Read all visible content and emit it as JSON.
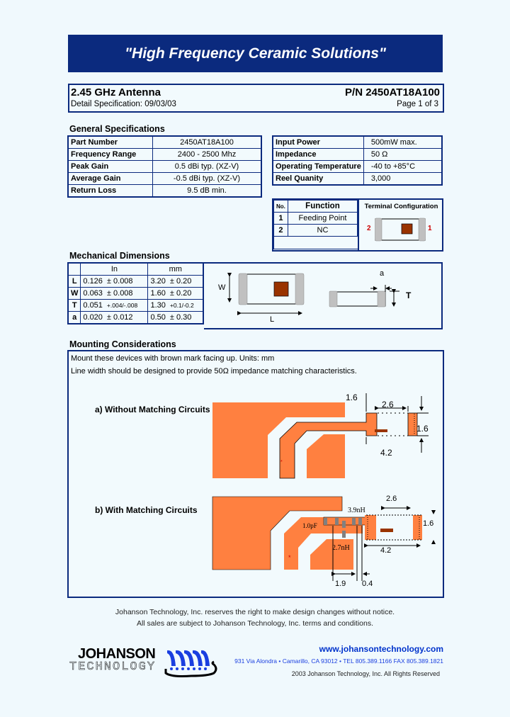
{
  "banner": {
    "slogan": "\"High Frequency Ceramic Solutions\""
  },
  "header": {
    "title": "2.45 GHz Antenna",
    "part_number": "P/N 2450AT18A100",
    "detail_spec": "Detail Specification:   09/03/03",
    "page": "Page 1 of 3"
  },
  "general_specs": {
    "heading": "General Specifications",
    "left_rows": [
      {
        "label": "Part Number",
        "value": "2450AT18A100"
      },
      {
        "label": "Frequency Range",
        "value": "2400 - 2500 Mhz"
      },
      {
        "label": "Peak Gain",
        "value": "0.5  dBi typ. (XZ-V)"
      },
      {
        "label": "Average Gain",
        "value": "-0.5  dBi typ. (XZ-V)"
      },
      {
        "label": "Return Loss",
        "value": "9.5 dB min."
      }
    ],
    "right_rows": [
      {
        "label": "Input Power",
        "value": "500mW max."
      },
      {
        "label": "Impedance",
        "value": "50 Ω"
      },
      {
        "label": "Operating Temperature",
        "value": "-40 to +85°C"
      },
      {
        "label": "Reel Quanity",
        "value": "3,000"
      }
    ]
  },
  "terminal": {
    "headers": {
      "no": "No.",
      "function": "Function",
      "config": "Terminal Configuration"
    },
    "rows": [
      {
        "no": "1",
        "function": "Feeding Point"
      },
      {
        "no": "2",
        "function": "NC"
      }
    ],
    "pin_left": "2",
    "pin_right": "1"
  },
  "mechanical": {
    "heading": "Mechanical Dimensions",
    "headers": {
      "in": "In",
      "mm": "mm"
    },
    "rows": [
      {
        "dim": "L",
        "in_val": "0.126",
        "in_tol": "±  0.008",
        "mm_val": "3.20",
        "mm_tol": "±  0.20"
      },
      {
        "dim": "W",
        "in_val": "0.063",
        "in_tol": "±  0.008",
        "mm_val": "1.60",
        "mm_tol": "±  0.20"
      },
      {
        "dim": "T",
        "in_val": "0.051",
        "in_tol": "+.004/-.008",
        "mm_val": "1.30",
        "mm_tol": "+0.1/-0.2"
      },
      {
        "dim": "a",
        "in_val": "0.020",
        "in_tol": "±  0.012",
        "mm_val": "0.50",
        "mm_tol": "±  0.30"
      }
    ],
    "diagram_labels": {
      "w": "W",
      "l": "L",
      "a": "a",
      "t": "T"
    }
  },
  "mounting": {
    "heading": "Mounting Considerations",
    "line1": "Mount these devices with brown mark facing up. Units: mm",
    "line2": "Line width should be designed to provide 50Ω impedance matching characteristics.",
    "a_label": "a) Without Matching Circuits",
    "b_label": "b) With Matching Circuits",
    "a_dims": {
      "d1": "1.6",
      "d2": "2.6",
      "d3": "1.6",
      "d4": "4.2"
    },
    "b_dims": {
      "d1": "2.6",
      "d2": "1.6",
      "d3": "4.2",
      "d4": "1.9",
      "d5": "0.4",
      "l1": "3.9nH",
      "c1": "1.0pF",
      "l2": "2.7nH"
    }
  },
  "footer": {
    "notice1": "Johanson Technology, Inc. reserves the right to make design changes without notice.",
    "notice2": "All sales are subject to Johanson Technology, Inc. terms and conditions.",
    "logo_top": "JOHANSON",
    "logo_bottom": "TECHNOLOGY",
    "website": "www.johansontechnology.com",
    "address": "931 Via Alondra • Camarillo, CA 93012 • TEL 805.389.1166 FAX 805.389.1821",
    "copyright": "2003 Johanson Technology, Inc.  All Rights Reserved"
  },
  "colors": {
    "navy": "#0b2a7e",
    "copper": "#ff8040",
    "brown_mark": "#993300",
    "terminal_gray": "#c0c0c0",
    "pin_red": "#cc0000",
    "link_blue": "#0033cc"
  }
}
